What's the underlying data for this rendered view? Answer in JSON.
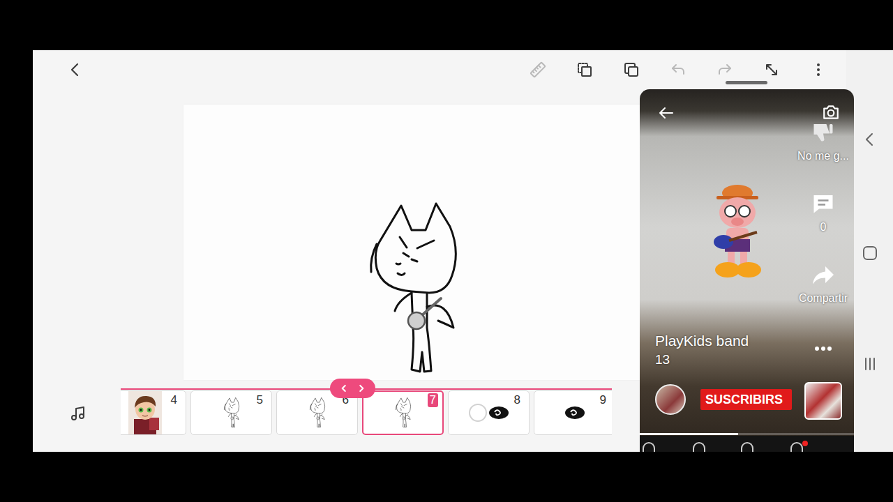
{
  "toolbar": {
    "items": [
      {
        "kind": "ruler",
        "disabled": true
      },
      {
        "kind": "copy",
        "disabled": false
      },
      {
        "kind": "layers",
        "disabled": false
      },
      {
        "kind": "undo",
        "disabled": true
      },
      {
        "kind": "redo",
        "disabled": true
      },
      {
        "kind": "expand",
        "disabled": false
      },
      {
        "kind": "more",
        "disabled": false
      }
    ]
  },
  "frames": [
    {
      "number": "4",
      "kind": "portrait",
      "selected": false
    },
    {
      "number": "5",
      "kind": "cat",
      "selected": false
    },
    {
      "number": "6",
      "kind": "cat",
      "selected": false
    },
    {
      "number": "7",
      "kind": "cat",
      "selected": true
    },
    {
      "number": "8",
      "kind": "blob-onion",
      "selected": false
    },
    {
      "number": "9",
      "kind": "blob",
      "selected": false
    }
  ],
  "video_window": {
    "actions": [
      {
        "kind": "dislike",
        "label": "No me g..."
      },
      {
        "kind": "comment",
        "label": "0"
      },
      {
        "kind": "share",
        "label": "Compartir"
      }
    ],
    "title": "PlayKids band",
    "subtitle": "13",
    "subscribe": "SUSCRIBIRS",
    "progress": {
      "level": 0.46
    }
  }
}
